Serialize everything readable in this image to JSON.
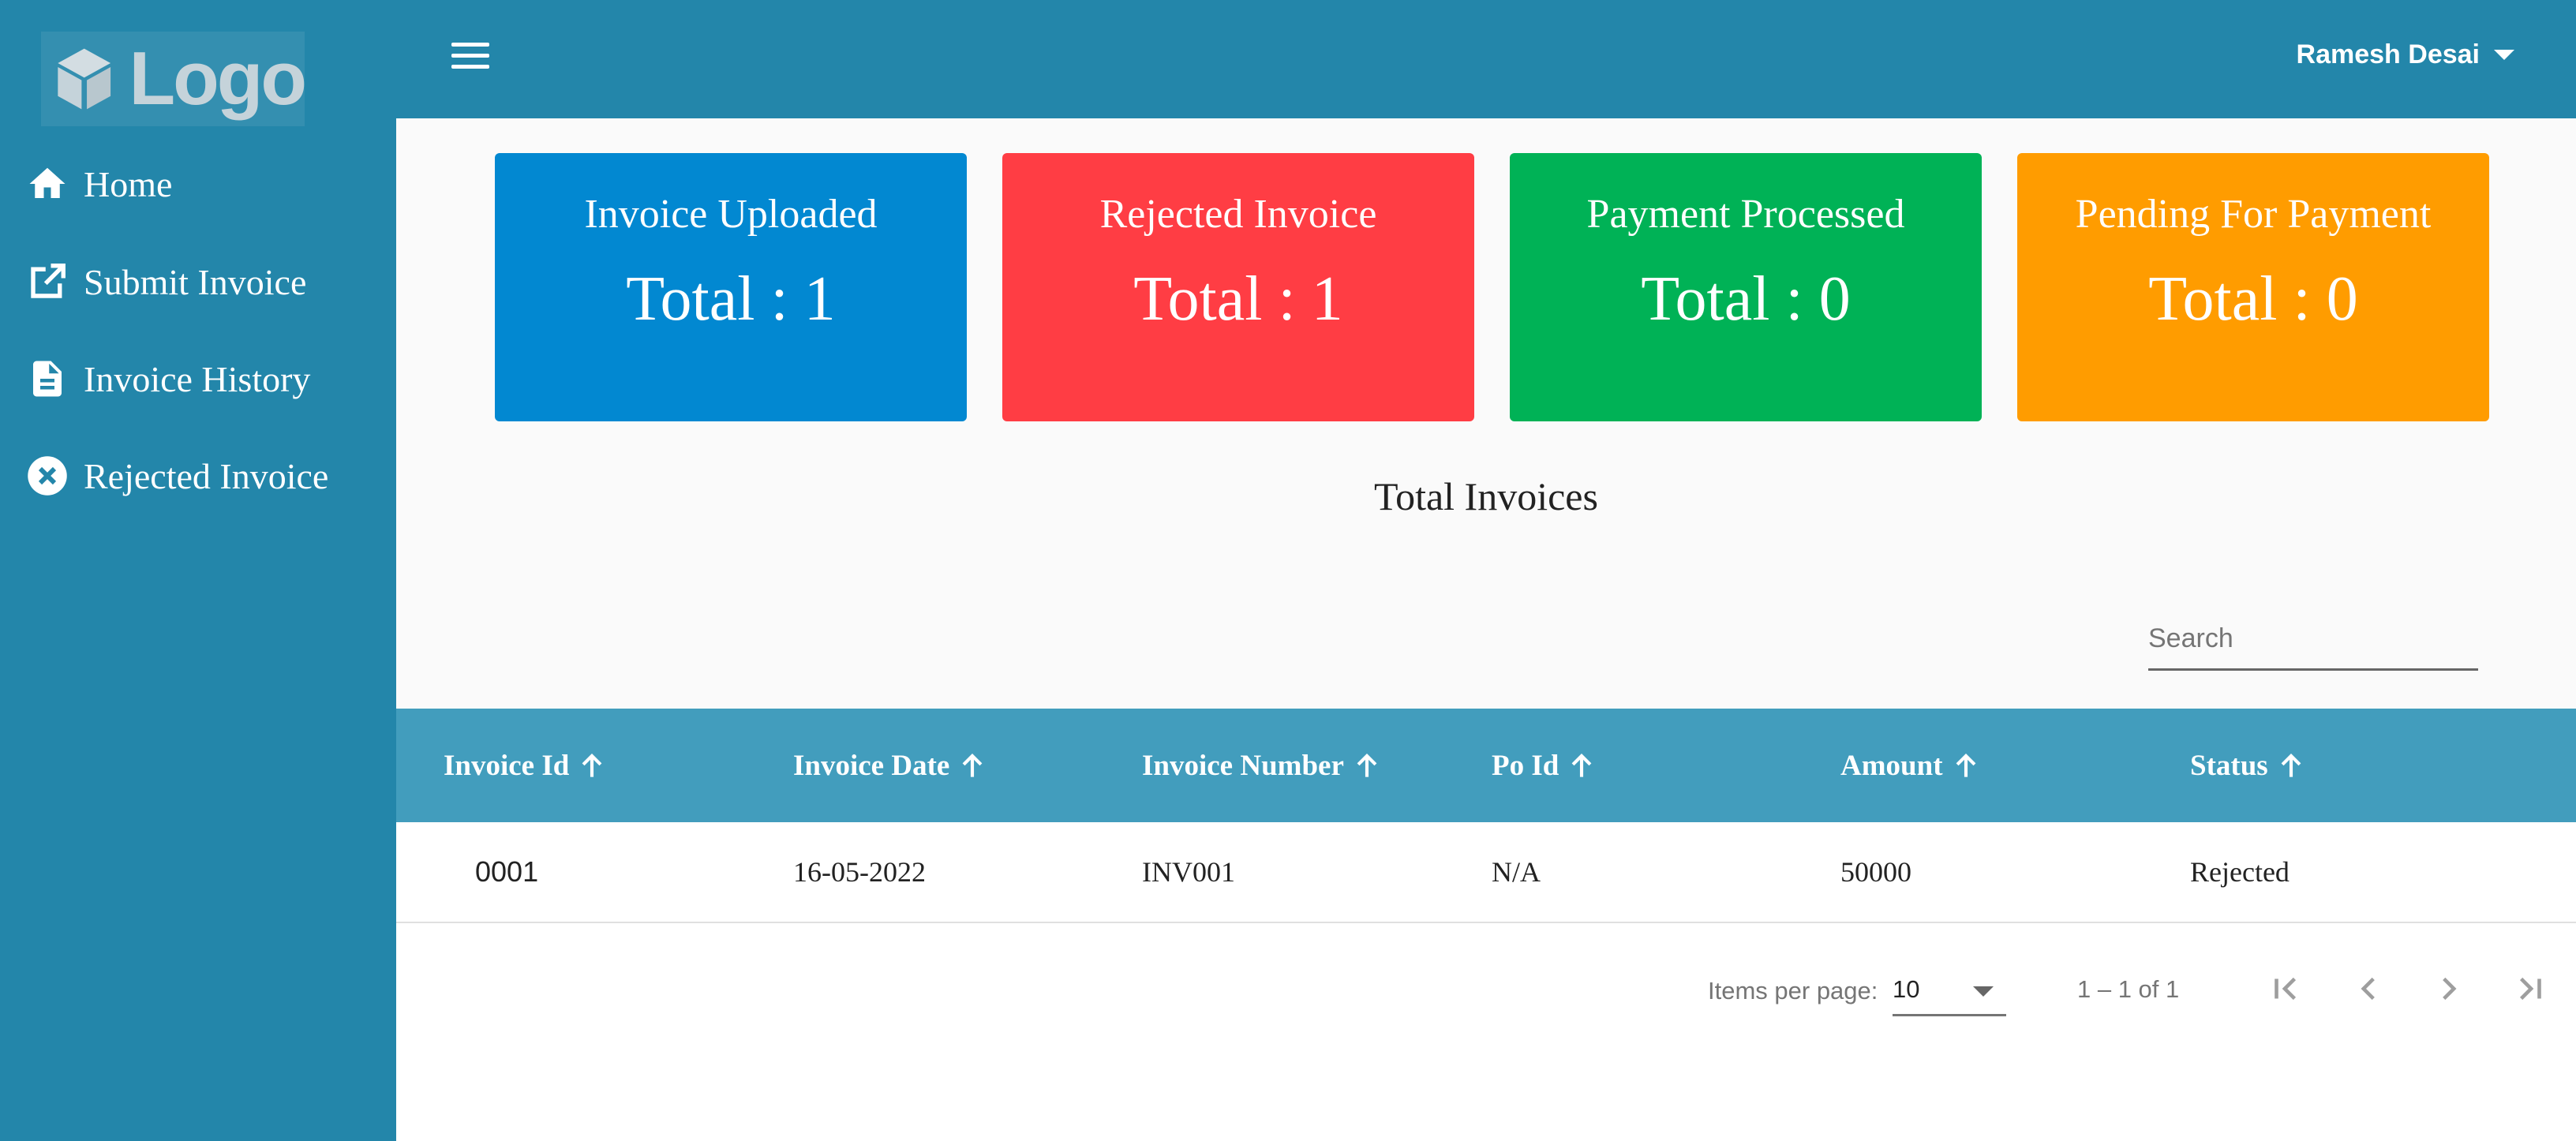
{
  "sidebar": {
    "logo_text": "Logo",
    "items": [
      {
        "label": "Home",
        "icon": "home-icon"
      },
      {
        "label": "Submit Invoice",
        "icon": "open-in-new-icon"
      },
      {
        "label": "Invoice History",
        "icon": "document-icon"
      },
      {
        "label": "Rejected Invoice",
        "icon": "cancel-circle-icon"
      }
    ]
  },
  "header": {
    "user_name": "Ramesh Desai"
  },
  "cards": [
    {
      "title": "Invoice Uploaded",
      "total": "Total : 1",
      "color": "#0288d1"
    },
    {
      "title": "Rejected Invoice",
      "total": "Total : 1",
      "color": "#ff3d44"
    },
    {
      "title": "Payment Processed",
      "total": "Total : 0",
      "color": "#00b256"
    },
    {
      "title": "Pending For Payment",
      "total": "Total : 0",
      "color": "#ff9c00"
    }
  ],
  "main": {
    "section_title": "Total Invoices",
    "search_placeholder": "Search"
  },
  "table": {
    "columns": [
      "Invoice Id",
      "Invoice Date",
      "Invoice Number",
      "Po Id",
      "Amount",
      "Status"
    ],
    "rows": [
      [
        "0001",
        "16-05-2022",
        "INV001",
        "N/A",
        "50000",
        "Rejected"
      ]
    ]
  },
  "paginator": {
    "items_per_page_label": "Items per page:",
    "page_size": "10",
    "range_label": "1 – 1 of 1"
  },
  "colors": {
    "sidebar_bg": "#2386aa",
    "table_header_bg": "#429dbd"
  }
}
